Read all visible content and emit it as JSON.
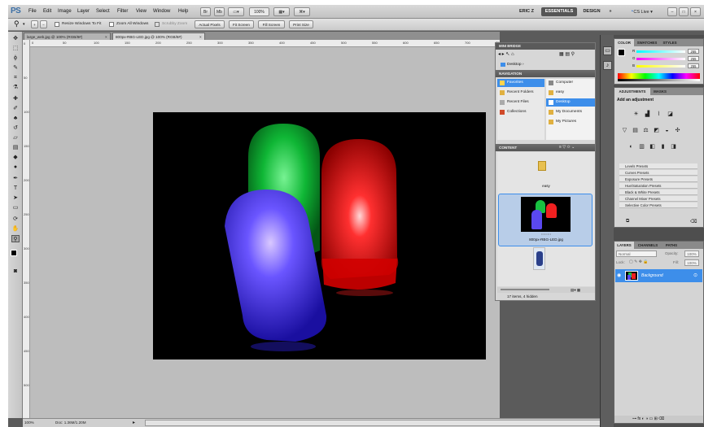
{
  "app": {
    "logo": "PS"
  },
  "menu": [
    "File",
    "Edit",
    "Image",
    "Layer",
    "Select",
    "Filter",
    "View",
    "Window",
    "Help"
  ],
  "menubar": {
    "zoom": "100%",
    "workspaces": [
      "ERIC Z",
      "ESSENTIALS",
      "DESIGN"
    ],
    "more": "»",
    "cslive": "CS Live ▾"
  },
  "options": {
    "resize_windows": "Resize Windows To Fit",
    "zoom_all": "Zoom All Windows",
    "scrubby_zoom": "Scrubby Zoom",
    "actual_pixels": "Actual Pixels",
    "fit_screen": "Fit Screen",
    "fill_screen": "Fill Screen",
    "print_size": "Print Size"
  },
  "tabs": [
    {
      "label": "large_web.jpg @ 100% (RGB/8#)",
      "close": "×"
    },
    {
      "label": "800px-RBG-LED.jpg @ 100% (RGB/8#)",
      "close": "×"
    }
  ],
  "ruler_h": [
    "0",
    "50",
    "100",
    "150",
    "200",
    "250",
    "300",
    "350",
    "400",
    "450",
    "500",
    "550",
    "600",
    "650",
    "700",
    "750"
  ],
  "ruler_v": [
    "0",
    "50",
    "100",
    "150",
    "200",
    "250",
    "300",
    "350",
    "400",
    "450",
    "500"
  ],
  "status": {
    "zoom": "100%",
    "doc": "Doc: 1.36M/1.20M"
  },
  "bridge": {
    "title": "MINI BRIDGE",
    "location": "Desktop",
    "navigation_header": "NAVIGATION",
    "nav_left": [
      {
        "label": "Favorites",
        "selected": true
      },
      {
        "label": "Recent Folders",
        "selected": false
      },
      {
        "label": "Recent Files",
        "selected": false
      },
      {
        "label": "Collections",
        "selected": false
      }
    ],
    "nav_right": [
      {
        "label": "Computer",
        "selected": false
      },
      {
        "label": "easy",
        "selected": false
      },
      {
        "label": "Desktop",
        "selected": true
      },
      {
        "label": "My Documents",
        "selected": false
      },
      {
        "label": "My Pictures",
        "selected": false
      }
    ],
    "content_header": "CONTENT",
    "folder_label": "easy",
    "thumb_label": "800px-RBG-LED.jpg",
    "stars": "• • • • •",
    "footer": "17 items, 4 hidden"
  },
  "color_panel": {
    "tabs": [
      "COLOR",
      "SWATCHES",
      "STYLES"
    ],
    "channels": [
      {
        "name": "R",
        "value": "255"
      },
      {
        "name": "G",
        "value": "255"
      },
      {
        "name": "B",
        "value": "255"
      }
    ]
  },
  "adjustments": {
    "tabs": [
      "ADJUSTMENTS",
      "MASKS"
    ],
    "heading": "Add an adjustment",
    "presets": [
      "Levels Presets",
      "Curves Presets",
      "Exposure Presets",
      "Hue/Saturation Presets",
      "Black & White Presets",
      "Channel Mixer Presets",
      "Selective Color Presets"
    ]
  },
  "layers": {
    "tabs": [
      "LAYERS",
      "CHANNELS",
      "PATHS"
    ],
    "blend": "Normal",
    "opacity_label": "Opacity:",
    "opacity": "100%",
    "lock_label": "Lock:",
    "fill_label": "Fill:",
    "fill": "100%",
    "layer_name": "Background"
  },
  "colors": {
    "accent": "#3d8eea",
    "layer_selected": "#3d8eea"
  }
}
